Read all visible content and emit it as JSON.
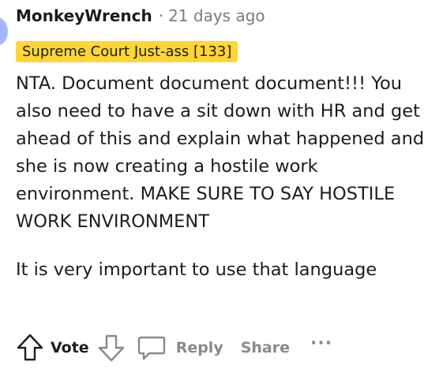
{
  "comment": {
    "author": "MonkeyWrench",
    "separator": "·",
    "timestamp": "21 days ago",
    "flair": "Supreme Court Just-ass [133]",
    "paragraphs": [
      "NTA. Document document document!!! You also need to have a sit down with HR and get ahead of this and explain what happened and she is now creating a hostile work environment. MAKE SURE TO SAY HOSTILE WORK ENVIRONMENT",
      "It is very important to use that language"
    ]
  },
  "actions": {
    "vote_label": "Vote",
    "reply_label": "Reply",
    "share_label": "Share",
    "more_label": "···"
  },
  "colors": {
    "flair_bg": "#ffd635",
    "muted_text": "#878a8c",
    "primary_text": "#1c1c1c"
  },
  "icons": {
    "upvote": "arrow-up-outline-icon",
    "downvote": "arrow-down-outline-icon",
    "reply": "speech-bubble-icon",
    "more": "ellipsis-icon"
  }
}
